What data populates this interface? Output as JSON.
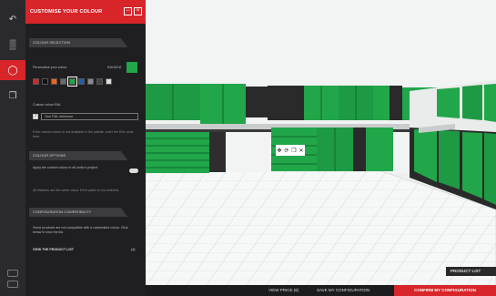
{
  "rail": {
    "icons": [
      "undo-icon",
      "chair-icon",
      "palette-icon",
      "copy-icon",
      "settings-icon",
      "save-icon"
    ]
  },
  "panel": {
    "title": "CUSTOMISE YOUR COLOUR",
    "close": "×",
    "colour_section": {
      "header": "COLOUR SELECTION",
      "label": "Personalise your colour",
      "code": "RAL6018",
      "swatches": [
        "#d8252a",
        "#111111",
        "#e8661c",
        "#6b6b6b",
        "#21a64a",
        "#1d5fb3",
        "#8a8a8a",
        "#444444",
        "#dddddd"
      ],
      "selected_index": 4,
      "big_swatch": "#21a64a"
    },
    "ral": {
      "label": "Custom colour RAL",
      "input_text": "Your RAL reference",
      "help": "If the custom colour is not available in the palette, enter the RAL code here."
    },
    "options": {
      "header": "COLOUR OPTIONS",
      "toggle_label": "Apply the custom colour to all units in project",
      "note": "All features are the same colour if the option is not selected."
    },
    "compat": {
      "header": "CONFIGURATION COMPATIBILITY",
      "text1": "Some products are not compatible with a customised colour. Click below to view the list.",
      "link": "VIEW THE PRODUCT LIST",
      "count": "(4)"
    }
  },
  "scene": {
    "hover_icons": [
      "move-icon",
      "rotate-icon",
      "duplicate-icon",
      "delete-icon"
    ]
  },
  "product_list": "PRODUCT LIST",
  "bottombar": {
    "item1": "VIEW PRICE (€)",
    "item2": "SAVE MY CONFIGURATION",
    "cta": "CONFIRM MY CONFIGURATION"
  },
  "colors": {
    "accent": "#d8252a",
    "cabinet_green": "#21a64a"
  }
}
